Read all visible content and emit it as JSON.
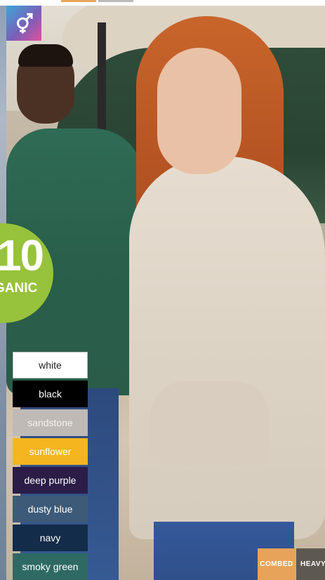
{
  "gender_icon": "unisex-gender-icon",
  "badge": {
    "number": "10",
    "label": "GANIC",
    "color": "#97c23b"
  },
  "swatches": [
    {
      "label": "white",
      "bg": "#ffffff",
      "fg": "#222222"
    },
    {
      "label": "black",
      "bg": "#000000",
      "fg": "#ffffff"
    },
    {
      "label": "sandstone",
      "bg": "#bfbab6",
      "fg": "#f3f1ef"
    },
    {
      "label": "sunflower",
      "bg": "#f5b51e",
      "fg": "#ffffff"
    },
    {
      "label": "deep purple",
      "bg": "#2b1d47",
      "fg": "#ffffff"
    },
    {
      "label": "dusty blue",
      "bg": "#3d5b79",
      "fg": "#ffffff"
    },
    {
      "label": "navy",
      "bg": "#132c4a",
      "fg": "#ffffff"
    },
    {
      "label": "smoky green",
      "bg": "#2e6a63",
      "fg": "#ffffff"
    }
  ],
  "tags": {
    "combed": "COMBED",
    "heavy": "HEAVY",
    "combed_color": "#e8a35a",
    "heavy_color": "#5e5852"
  }
}
